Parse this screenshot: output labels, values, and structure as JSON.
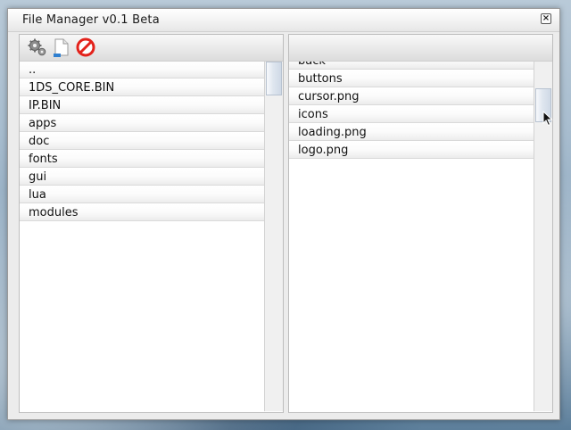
{
  "window": {
    "title": "File Manager v0.1 Beta",
    "close_glyph": "×"
  },
  "toolbar": {
    "icons": [
      "settings-gears-icon",
      "new-file-icon",
      "delete-no-icon"
    ]
  },
  "left_pane": {
    "items": [
      {
        "label": ".."
      },
      {
        "label": "1DS_CORE.BIN"
      },
      {
        "label": "IP.BIN"
      },
      {
        "label": "apps"
      },
      {
        "label": "doc"
      },
      {
        "label": "fonts"
      },
      {
        "label": "gui"
      },
      {
        "label": "lua"
      },
      {
        "label": "modules"
      }
    ]
  },
  "right_pane": {
    "items": [
      {
        "label": "back"
      },
      {
        "label": "buttons"
      },
      {
        "label": "cursor.png"
      },
      {
        "label": "icons"
      },
      {
        "label": "loading.png"
      },
      {
        "label": "logo.png"
      }
    ]
  },
  "colors": {
    "delete_icon": "#e3221b",
    "scroll_thumb": "#dfe6ef"
  }
}
